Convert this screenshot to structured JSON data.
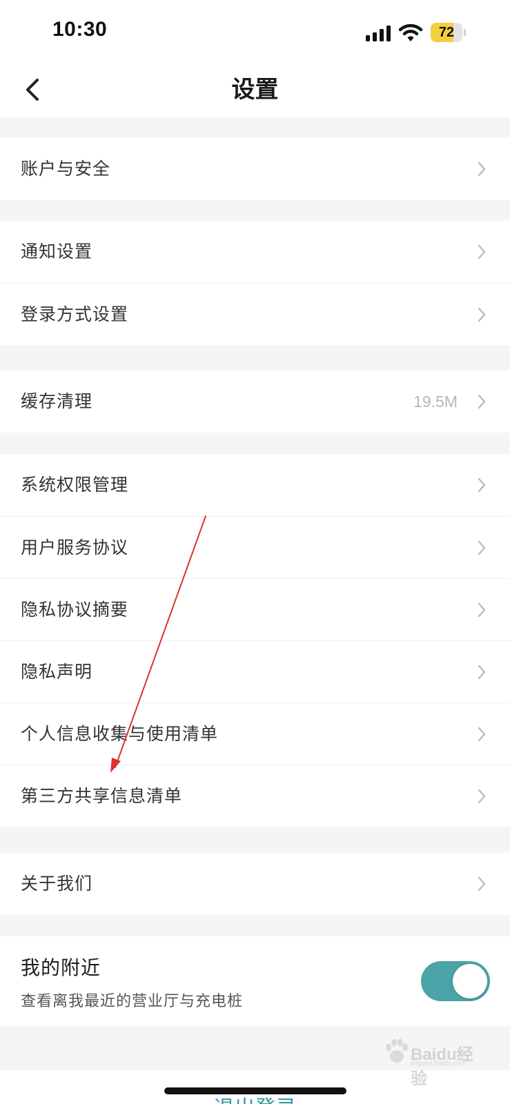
{
  "status_bar": {
    "time": "10:30",
    "battery_level": "72",
    "battery_fraction": 0.72,
    "battery_color": "#f4cf3d"
  },
  "nav": {
    "title": "设置",
    "back_icon": "chevron-left-icon"
  },
  "groups": [
    {
      "items": [
        {
          "label": "账户与安全",
          "name": "account-security"
        }
      ]
    },
    {
      "items": [
        {
          "label": "通知设置",
          "name": "notification-settings"
        },
        {
          "label": "登录方式设置",
          "name": "login-method-settings"
        }
      ]
    },
    {
      "items": [
        {
          "label": "缓存清理",
          "name": "cache-cleanup",
          "value": "19.5M"
        }
      ]
    },
    {
      "items": [
        {
          "label": "系统权限管理",
          "name": "system-permissions"
        },
        {
          "label": "用户服务协议",
          "name": "user-service-agreement"
        },
        {
          "label": "隐私协议摘要",
          "name": "privacy-agreement-summary"
        },
        {
          "label": "隐私声明",
          "name": "privacy-statement"
        },
        {
          "label": "个人信息收集与使用清单",
          "name": "personal-info-collection-list"
        },
        {
          "label": "第三方共享信息清单",
          "name": "third-party-sharing-list"
        }
      ]
    },
    {
      "items": [
        {
          "label": "关于我们",
          "name": "about-us"
        }
      ]
    }
  ],
  "nearby": {
    "title": "我的附近",
    "subtitle": "查看离我最近的营业厅与充电桩",
    "enabled": true,
    "toggle_color": "#4aa3a7"
  },
  "logout": {
    "label": "退出登录"
  },
  "annotation": {
    "color": "#e0312b"
  },
  "watermark": {
    "brand": "Baidu经验",
    "site": "jingyan.baidu.com"
  }
}
